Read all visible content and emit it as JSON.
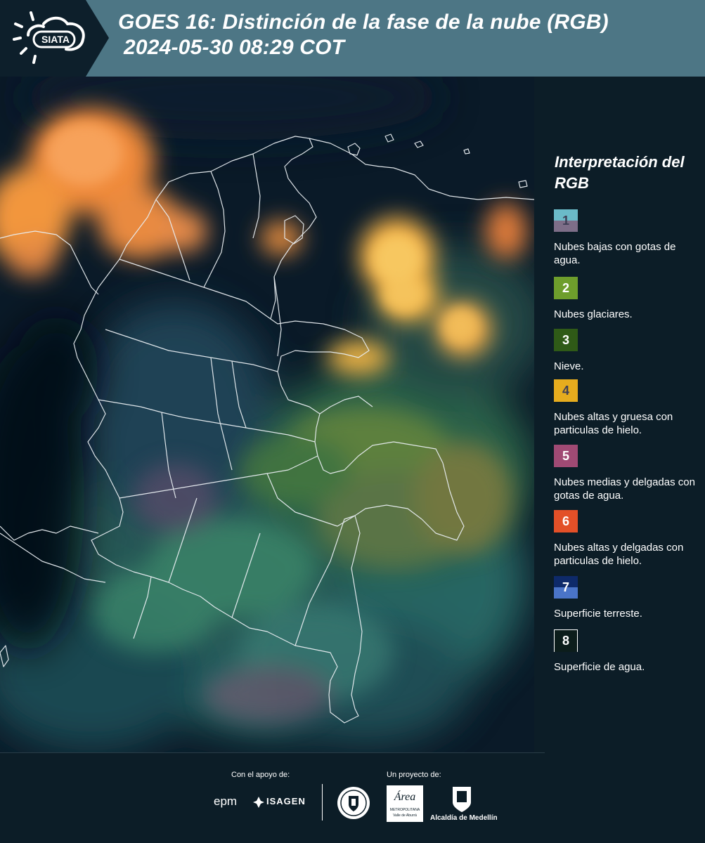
{
  "header": {
    "title": "GOES 16: Distinción de la fase de la nube (RGB)",
    "timestamp": "2024-05-30 08:29 COT",
    "logo_text": "SIATA",
    "logo_icon": "sun-cloud-icon"
  },
  "map": {
    "subject": "Satellite RGB composite over Colombia and neighbouring region",
    "icon": "satellite-map"
  },
  "legend": {
    "title": "Interpretación del RGB",
    "items": [
      {
        "number": "1",
        "label": "Nubes bajas con gotas de agua.",
        "color_top": "#6bbac8",
        "color_bottom": "#7d6e88",
        "num_color": "#3e3e55"
      },
      {
        "number": "2",
        "label": "Nubes glaciares.",
        "color_top": "#6e9e2c",
        "color_bottom": "#6e9e2c",
        "num_color": "#ffffff"
      },
      {
        "number": "3",
        "label": "Nieve.",
        "color_top": "#2f5a17",
        "color_bottom": "#2f5a17",
        "num_color": "#ffffff"
      },
      {
        "number": "4",
        "label": "Nubes altas y gruesa con particulas de hielo.",
        "color_top": "#e6ac1e",
        "color_bottom": "#e6ac1e",
        "num_color": "#3e3e55"
      },
      {
        "number": "5",
        "label": "Nubes medias y delgadas con gotas de agua.",
        "color_top": "#a04a74",
        "color_bottom": "#a04a74",
        "num_color": "#ffffff"
      },
      {
        "number": "6",
        "label": "Nubes altas y delgadas con particulas de hielo.",
        "color_top": "#e35028",
        "color_bottom": "#e35028",
        "num_color": "#ffffff"
      },
      {
        "number": "7",
        "label": "Superficie terreste.",
        "color_top": "#0e2a6a",
        "color_bottom": "#4a74c8",
        "num_color": "#ffffff"
      },
      {
        "number": "8",
        "label": "Superficie de agua.",
        "color_top": "#0c1d1b",
        "color_bottom": "#0c1d1b",
        "num_color": "#ffffff"
      }
    ]
  },
  "footer": {
    "support_label": "Con el apoyo de:",
    "project_label": "Un proyecto de:",
    "epm_text": "epm",
    "isagen_text": "ISAGEN",
    "area_text": "Área",
    "area_sub": "METROPOLITANA",
    "area_sub2": "Valle de Aburrá",
    "alcaldia_text": "Alcaldía de Medellín"
  }
}
